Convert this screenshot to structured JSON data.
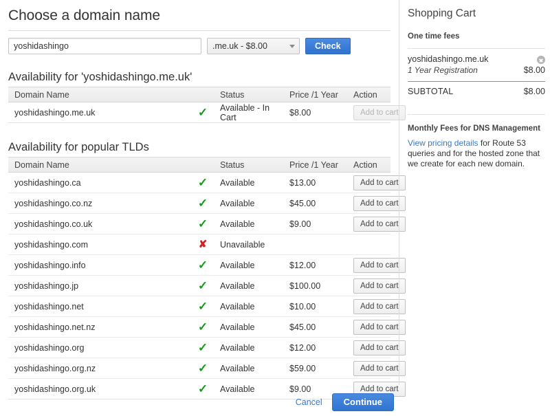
{
  "page": {
    "title": "Choose a domain name"
  },
  "search": {
    "input_value": "yoshidashingo",
    "input_placeholder": "",
    "tld_selected": ".me.uk - $8.00",
    "check_label": "Check"
  },
  "primary_section": {
    "heading": "Availability for 'yoshidashingo.me.uk'",
    "columns": [
      "Domain Name",
      "",
      "Status",
      "Price /1 Year",
      "Action"
    ],
    "rows": [
      {
        "domain": "yoshidashingo.me.uk",
        "icon": "check-icon",
        "status": "Available - In Cart",
        "price": "$8.00",
        "action_label": "Add to cart",
        "action_disabled": true
      }
    ]
  },
  "tld_section": {
    "heading": "Availability for popular TLDs",
    "columns": [
      "Domain Name",
      "",
      "Status",
      "Price /1 Year",
      "Action"
    ],
    "rows": [
      {
        "domain": "yoshidashingo.ca",
        "icon": "check-icon",
        "status": "Available",
        "price": "$13.00",
        "action_label": "Add to cart",
        "action_disabled": false
      },
      {
        "domain": "yoshidashingo.co.nz",
        "icon": "check-icon",
        "status": "Available",
        "price": "$45.00",
        "action_label": "Add to cart",
        "action_disabled": false
      },
      {
        "domain": "yoshidashingo.co.uk",
        "icon": "check-icon",
        "status": "Available",
        "price": "$9.00",
        "action_label": "Add to cart",
        "action_disabled": false
      },
      {
        "domain": "yoshidashingo.com",
        "icon": "x-icon",
        "status": "Unavailable",
        "price": "",
        "action_label": "",
        "action_disabled": false
      },
      {
        "domain": "yoshidashingo.info",
        "icon": "check-icon",
        "status": "Available",
        "price": "$12.00",
        "action_label": "Add to cart",
        "action_disabled": false
      },
      {
        "domain": "yoshidashingo.jp",
        "icon": "check-icon",
        "status": "Available",
        "price": "$100.00",
        "action_label": "Add to cart",
        "action_disabled": false
      },
      {
        "domain": "yoshidashingo.net",
        "icon": "check-icon",
        "status": "Available",
        "price": "$10.00",
        "action_label": "Add to cart",
        "action_disabled": false
      },
      {
        "domain": "yoshidashingo.net.nz",
        "icon": "check-icon",
        "status": "Available",
        "price": "$45.00",
        "action_label": "Add to cart",
        "action_disabled": false
      },
      {
        "domain": "yoshidashingo.org",
        "icon": "check-icon",
        "status": "Available",
        "price": "$12.00",
        "action_label": "Add to cart",
        "action_disabled": false
      },
      {
        "domain": "yoshidashingo.org.nz",
        "icon": "check-icon",
        "status": "Available",
        "price": "$59.00",
        "action_label": "Add to cart",
        "action_disabled": false
      },
      {
        "domain": "yoshidashingo.org.uk",
        "icon": "check-icon",
        "status": "Available",
        "price": "$9.00",
        "action_label": "Add to cart",
        "action_disabled": false
      }
    ]
  },
  "cart": {
    "title": "Shopping Cart",
    "one_time_fees_label": "One time fees",
    "items": [
      {
        "domain": "yoshidashingo.me.uk",
        "description": "1 Year Registration",
        "amount": "$8.00",
        "remove_icon": "remove-circle-icon"
      }
    ],
    "subtotal_label": "SUBTOTAL",
    "subtotal_amount": "$8.00",
    "dns": {
      "heading": "Monthly Fees for DNS Management",
      "link_text": "View pricing details",
      "body_text": " for Route 53 queries and for the hosted zone that we create for each new domain."
    }
  },
  "footer": {
    "cancel_label": "Cancel",
    "continue_label": "Continue"
  },
  "colors": {
    "accent_blue": "#3a78c8",
    "button_blue": "#2f74d0",
    "available_green": "#179b1f",
    "unavailable_red": "#cf2222",
    "text": "#333333",
    "border": "#dcdcdc"
  }
}
